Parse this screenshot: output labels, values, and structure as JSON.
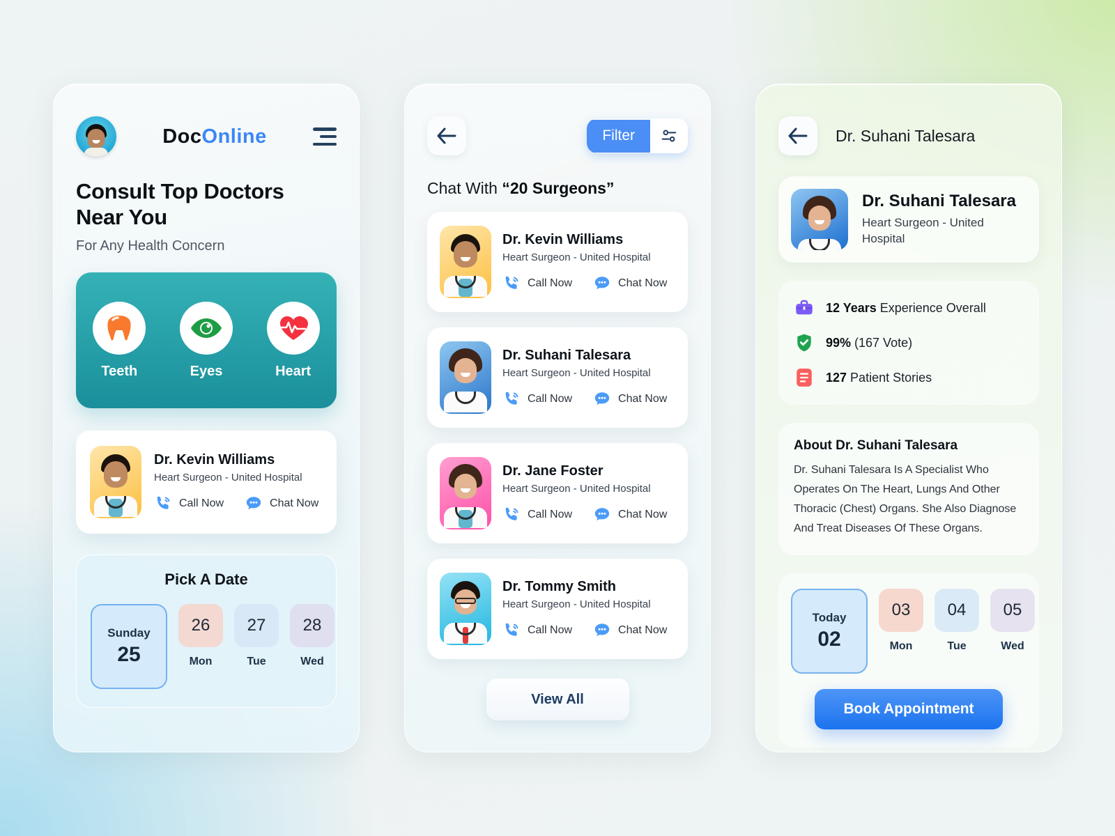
{
  "panel1": {
    "logo": {
      "part_a": "Doc",
      "part_b": "Online",
      "accent": "#3b87f7"
    },
    "avatar_name": "user-avatar",
    "headline": "Consult Top Doctors Near You",
    "headline_line1": "Consult Top Doctors",
    "headline_line2": "Near You",
    "subhead": "For Any Health Concern",
    "categories": [
      {
        "label": "Teeth",
        "icon": "tooth-icon",
        "color": "#f97a2e"
      },
      {
        "label": "Eyes",
        "icon": "eye-icon",
        "color": "#1f9d44"
      },
      {
        "label": "Heart",
        "icon": "heart-pulse-icon",
        "color": "#f5313f"
      }
    ],
    "featured_doctor": {
      "name": "Dr. Kevin Williams",
      "role": "Heart Surgeon - United Hospital",
      "call_label": "Call Now",
      "chat_label": "Chat Now",
      "avatar_bg": "amber"
    },
    "datepicker": {
      "title": "Pick A Date",
      "selected": {
        "day_name": "Sunday",
        "date": "25"
      },
      "days": [
        {
          "date": "26",
          "day": "Mon",
          "chip_color": "#f3d9d2"
        },
        {
          "date": "27",
          "day": "Tue",
          "chip_color": "#d9e8f6"
        },
        {
          "date": "28",
          "day": "Wed",
          "chip_color": "#dfdff0"
        }
      ]
    }
  },
  "panel2": {
    "back_icon": "back-arrow-icon",
    "filter_label": "Filter",
    "filter_icon": "sliders-icon",
    "list_title_prefix": "Chat With ",
    "list_title_emphasis": "“20 Surgeons”",
    "doctors": [
      {
        "name": "Dr. Kevin Williams",
        "role": "Heart Surgeon - United Hospital",
        "call_label": "Call Now",
        "chat_label": "Chat Now",
        "avatar_bg": "amber"
      },
      {
        "name": "Dr. Suhani Talesara",
        "role": "Heart Surgeon - United Hospital",
        "call_label": "Call Now",
        "chat_label": "Chat Now",
        "avatar_bg": "blue"
      },
      {
        "name": "Dr. Jane Foster",
        "role": "Heart Surgeon - United Hospital",
        "call_label": "Call Now",
        "chat_label": "Chat Now",
        "avatar_bg": "pink"
      },
      {
        "name": "Dr. Tommy Smith",
        "role": "Heart Surgeon - United Hospital",
        "call_label": "Call Now",
        "chat_label": "Chat Now",
        "avatar_bg": "cyan"
      }
    ],
    "view_all_label": "View All"
  },
  "panel3": {
    "back_icon": "back-arrow-icon",
    "header_title": "Dr. Suhani Talesara",
    "profile": {
      "name": "Dr. Suhani Talesara",
      "role": "Heart Surgeon - United Hospital",
      "avatar_bg": "blue2"
    },
    "stats": [
      {
        "icon": "briefcase-icon",
        "color": "#7c5cf5",
        "value": "12 Years",
        "text": " Experience Overall"
      },
      {
        "icon": "shield-check-icon",
        "color": "#1ea34e",
        "value": "99%",
        "text": " (167 Vote)"
      },
      {
        "icon": "document-icon",
        "color": "#fb5e5e",
        "value": "127",
        "text": " Patient Stories"
      }
    ],
    "about": {
      "title": "About Dr. Suhani Talesara",
      "body": "Dr. Suhani Talesara Is A Specialist Who Operates On The Heart, Lungs And Other Thoracic (Chest) Organs. She Also Diagnose And Treat Diseases Of These Organs."
    },
    "datepicker": {
      "selected": {
        "day_name": "Today",
        "date": "02"
      },
      "days": [
        {
          "date": "03",
          "day": "Mon",
          "chip_color": "#f6d8ce"
        },
        {
          "date": "04",
          "day": "Tue",
          "chip_color": "#dbeaf7"
        },
        {
          "date": "05",
          "day": "Wed",
          "chip_color": "#e6e2ef"
        }
      ]
    },
    "book_label": "Book Appointment"
  }
}
